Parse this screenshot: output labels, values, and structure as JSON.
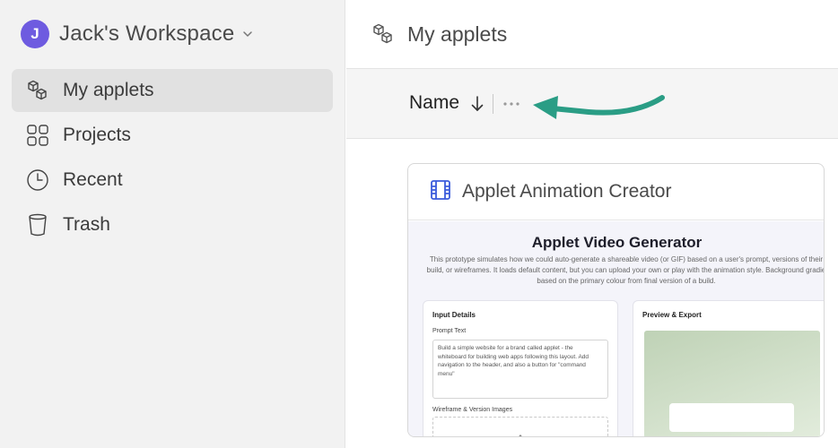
{
  "workspace": {
    "avatar_initial": "J",
    "name": "Jack's Workspace"
  },
  "sidebar": {
    "items": [
      {
        "label": "My applets",
        "icon": "cubes-icon",
        "active": true
      },
      {
        "label": "Projects",
        "icon": "grid-icon"
      },
      {
        "label": "Recent",
        "icon": "clock-icon"
      },
      {
        "label": "Trash",
        "icon": "trash-icon"
      }
    ]
  },
  "main": {
    "title": "My applets",
    "toolbar": {
      "sort_label": "Name"
    },
    "card": {
      "title": "Applet Animation Creator",
      "icon": "film-icon",
      "preview": {
        "title": "Applet Video Generator",
        "description": "This prototype simulates how we could auto-generate a shareable video (or GIF) based on a user's prompt, versions of their\nbuild, or wireframes. It loads default content, but you can upload your own or play with the animation style. Background gradie\nbased on the primary colour from final version of a build.",
        "input_panel_title": "Input Details",
        "prompt_label": "Prompt Text",
        "prompt_text": "Build a simple website for a brand called applet - the whiteboard for building web apps following this layout. Add navigation to the header, and also a button for \"command menu\"",
        "images_label": "Wireframe & Version Images",
        "export_panel_title": "Preview & Export"
      }
    }
  },
  "colors": {
    "avatar": "#6e5be0",
    "card_icon": "#3b5bdb",
    "annotation_arrow": "#2a9d85"
  }
}
